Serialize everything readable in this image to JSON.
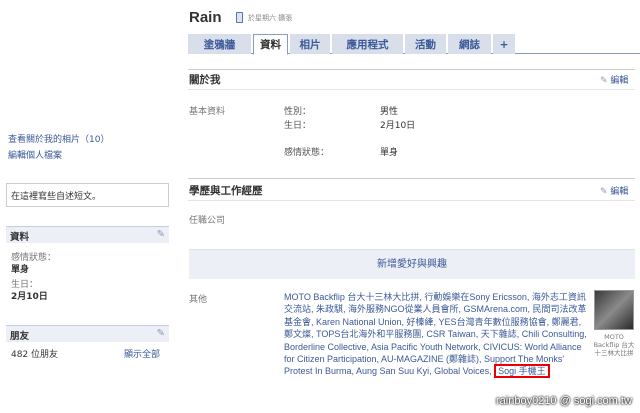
{
  "profile": {
    "name": "Rain",
    "mobile_text": "於星期六 擴張"
  },
  "tabs": [
    "塗鴉牆",
    "資料",
    "相片",
    "應用程式",
    "活動",
    "網誌",
    "+"
  ],
  "left": {
    "links": [
      "查看關於我的相片（10）",
      "編輯個人檔案"
    ],
    "status_placeholder": "在這裡寫些自述短文。",
    "info_section": {
      "title": "資料",
      "relationship_label": "感情狀態：",
      "relationship_value": "單身",
      "birthday_label": "生日：",
      "birthday_value": "2月10日"
    },
    "friends_section": {
      "title": "朋友",
      "count": "482 位朋友",
      "show_all": "顯示全部"
    }
  },
  "about": {
    "title": "關於我",
    "edit": "編輯",
    "basic_label": "基本資料",
    "gender_label": "性別：",
    "gender_value": "男性",
    "birthday_label": "生日：",
    "birthday_value": "2月10日",
    "relationship_label": "感情狀態：",
    "relationship_value": "單身"
  },
  "education": {
    "title": "學歷與工作經歷",
    "edit": "編輯",
    "employer_label": "任職公司"
  },
  "interests": {
    "add_label": "新增愛好與興趣",
    "other_label": "其他",
    "other_text": "MOTO Backflip 台大十三林大比拼, 行動娛樂在Sony Ericsson, 海外志工資訊交流站, 朱政騏, 海外服務NGO從業人員會所, GSMArena.com, 民間司法改革基金會, Karen National Union, 好榛縴, YES台灣青年數位服務協會, 鄭麗君, 鄭文燦, TOPS台北海外和平服務團, CSR Taiwan, 天下雜誌, Chili Consulting, Borderline Collective, Asia Pacific Youth Network, CIVICUS: World Alliance for Citizen Participation, AU-MAGAZINE (鄭雜誌), Support The Monks' Protest In Burma, Aung San Suu Kyi, Global Voices,",
    "highlighted": "Sogi 手機王",
    "thumb_caption": "MOTO Backflip 台大十三林大比拼"
  },
  "watermark": "rainboy0210 @ sogi.com.tw",
  "colors": {
    "link": "#3b5998",
    "tab_bg": "#d8dfea",
    "highlight": "#ee0000"
  }
}
